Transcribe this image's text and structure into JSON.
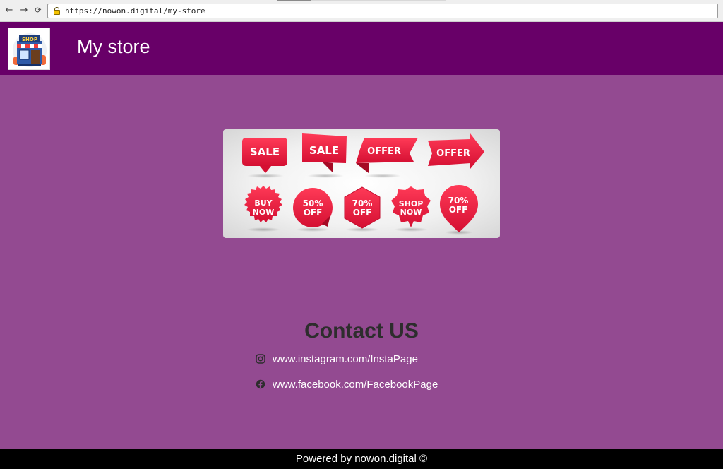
{
  "browser": {
    "nav": {
      "back": "←",
      "forward": "→",
      "reload": "⟳"
    },
    "url": "https://nowon.digital/my-store"
  },
  "header": {
    "title": "My store",
    "logo_text": "SHOP",
    "logo_icon": "storefront-icon"
  },
  "banner": {
    "stickers_row1": [
      "SALE",
      "SALE",
      "OFFER",
      "OFFER"
    ],
    "stickers_row2": [
      {
        "line1": "BUY",
        "line2": "NOW"
      },
      {
        "line1": "50%",
        "line2": "OFF"
      },
      {
        "line1": "70%",
        "line2": "OFF"
      },
      {
        "line1": "SHOP",
        "line2": "NOW"
      },
      {
        "line1": "70%",
        "line2": "OFF"
      }
    ]
  },
  "contact": {
    "title": "Contact US",
    "instagram": {
      "icon": "instagram-icon",
      "label": "www.instagram.com/InstaPage"
    },
    "facebook": {
      "icon": "facebook-icon",
      "label": "www.facebook.com/FacebookPage"
    }
  },
  "footer": {
    "text": "Powered by nowon.digital ©"
  },
  "colors": {
    "header_bg": "#680068",
    "page_bg": "#934a91",
    "sticker_red": "#e8163c",
    "footer_bg": "#000000"
  }
}
